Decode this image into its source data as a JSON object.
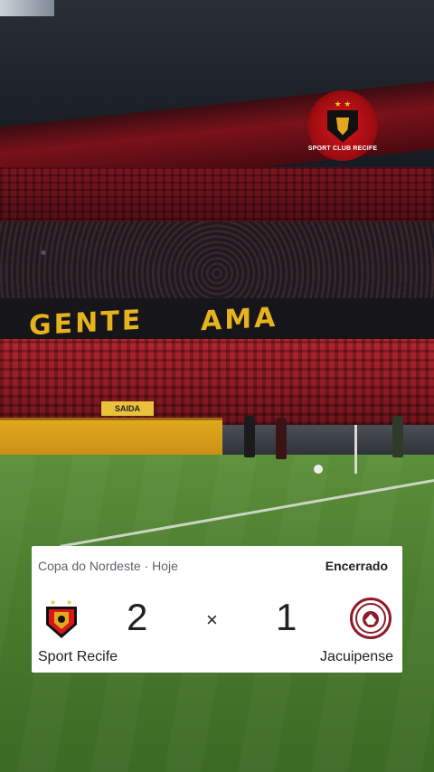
{
  "scene": {
    "banner_left": "GENTE",
    "banner_right": "AMA",
    "exit_sign": "SAIDA",
    "corner_logo_text": "SPORT CLUB RECIFE"
  },
  "scorecard": {
    "competition": "Copa do Nordeste · Hoje",
    "status": "Encerrado",
    "separator": "×",
    "home": {
      "name": "Sport Recife",
      "score": "2",
      "logo": "sport-recife-crest-icon"
    },
    "away": {
      "name": "Jacuipense",
      "score": "1",
      "logo": "jacuipense-crest-icon"
    },
    "colors": {
      "home_red": "#d6161b",
      "home_gold": "#e3a81c",
      "away_maroon": "#8d1a2a"
    }
  }
}
